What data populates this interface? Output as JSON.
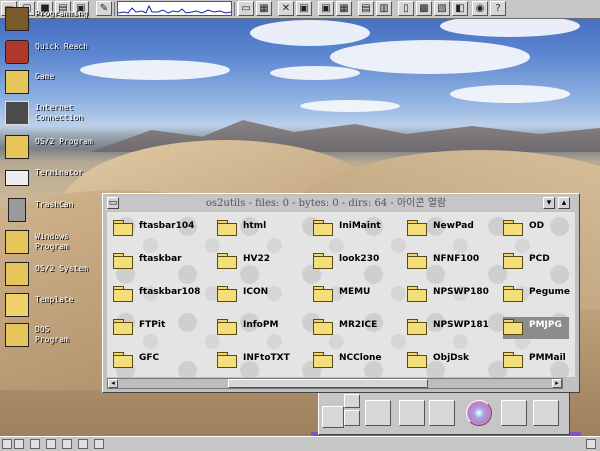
{
  "desktop": {
    "icons": [
      {
        "label": "Programming",
        "icon": "programming-icon"
      },
      {
        "label": "Quick Reach",
        "icon": "quick-reach-icon"
      },
      {
        "label": "Game",
        "icon": "game-folder-icon"
      },
      {
        "label": "Internet\nConnection",
        "icon": "internet-icon"
      },
      {
        "label": "OS/2 Program",
        "icon": "os2-program-icon"
      },
      {
        "label": "Terminator",
        "icon": "printer-icon"
      },
      {
        "label": "TrashCan",
        "icon": "trashcan-icon"
      },
      {
        "label": "Windows\nProgram",
        "icon": "windows-program-icon"
      },
      {
        "label": "OS/2 System",
        "icon": "os2-system-icon"
      },
      {
        "label": "Template",
        "icon": "template-icon"
      },
      {
        "label": "DOS\nProgram",
        "icon": "dos-program-icon"
      }
    ]
  },
  "window": {
    "title": "os2utils - files: 0 - bytes: 0 - dirs: 64 - 아이콘 열람",
    "folders": [
      "ftasbar104",
      "html",
      "IniMaint",
      "NewPad",
      "OD",
      "ftaskbar",
      "HV22",
      "look230",
      "NFNF100",
      "PCD",
      "ftaskbar108",
      "ICON",
      "MEMU",
      "NPSWP180",
      "Pegume",
      "FTPit",
      "InfoPM",
      "MR2ICE",
      "NPSWP181",
      "PMJPG",
      "GFC",
      "INFtoTXT",
      "NCClone",
      "ObjDsk",
      "PMMail"
    ],
    "selected": "PMJPG"
  },
  "colors": {
    "folder_fill": "#f3de79",
    "selection": "#8c8c8c",
    "frame_purple": "#7f55b8",
    "chrome": "#c6c6c6"
  }
}
